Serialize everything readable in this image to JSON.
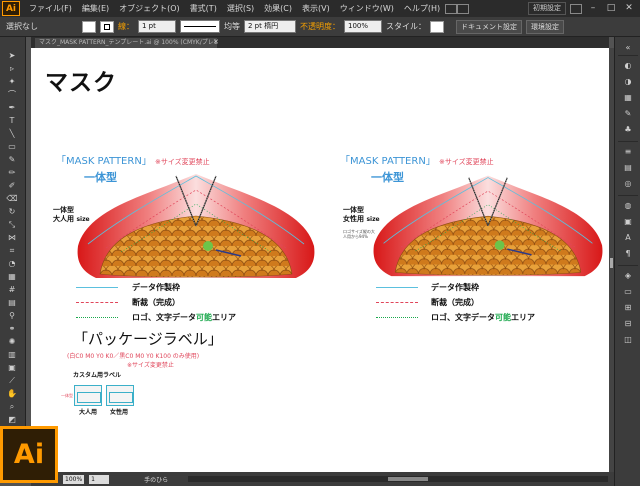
{
  "app": {
    "logo_text": "Ai"
  },
  "menubar": {
    "items": [
      "ファイル(F)",
      "編集(E)",
      "オブジェクト(O)",
      "書式(T)",
      "選択(S)",
      "効果(C)",
      "表示(V)",
      "ウィンドウ(W)",
      "ヘルプ(H)"
    ],
    "workspace": "初期設定",
    "window_buttons": [
      "–",
      "□",
      "✕"
    ]
  },
  "controlbar": {
    "selection": "選択なし",
    "stroke_label": "線：",
    "stroke_weight": "1 pt",
    "profile": "均等",
    "brush": "2 pt 楕円",
    "opacity_label": "不透明度：",
    "opacity_value": "100%",
    "style_label": "スタイル：",
    "doc_setup_button": "ドキュメント設定",
    "prefs_button": "環境設定"
  },
  "document_tab": {
    "title": "マスク_MASK PATTERN_テンプレート.ai @ 100% (CMYK/プレビュー)",
    "close": "✕"
  },
  "canvas": {
    "title": "マスク",
    "patterns": [
      {
        "heading": "「MASK PATTERN」",
        "note": "※サイズ変更禁止",
        "type": "一体型",
        "size_line1": "一体型",
        "size_line2": "大人用",
        "size_suffix": "size"
      },
      {
        "heading": "「MASK PATTERN」",
        "note": "※サイズ変更禁止",
        "type": "一体型",
        "size_line1": "一体型",
        "size_line2": "女性用",
        "size_suffix": "size",
        "small_note": "ロゴサイズ縦の大人用から94%"
      }
    ],
    "legend": {
      "frame": "データ作製枠",
      "trim": "断裁（完成）",
      "safe_prefix": "ロゴ、文字データ",
      "safe_green": "可能",
      "safe_suffix": "エリア"
    },
    "package": {
      "title": "「パッケージラベル」",
      "color_note": "(白C0 M0 Y0 K0／黒C0 M0 Y0 K100 のみ使用)",
      "size_note": "※サイズ変更禁止",
      "custom_label": "カスタム用ラベル",
      "side_note": "一体型",
      "adult": "大人用",
      "female": "女性用"
    }
  },
  "statusbar": {
    "zoom": "100%",
    "page": "1",
    "tool": "手のひら"
  },
  "colors": {
    "accent_blue": "#3d95d6",
    "note_red": "#e0455a",
    "safe_green": "#1aa84c",
    "ai_orange": "#ff9a00"
  }
}
